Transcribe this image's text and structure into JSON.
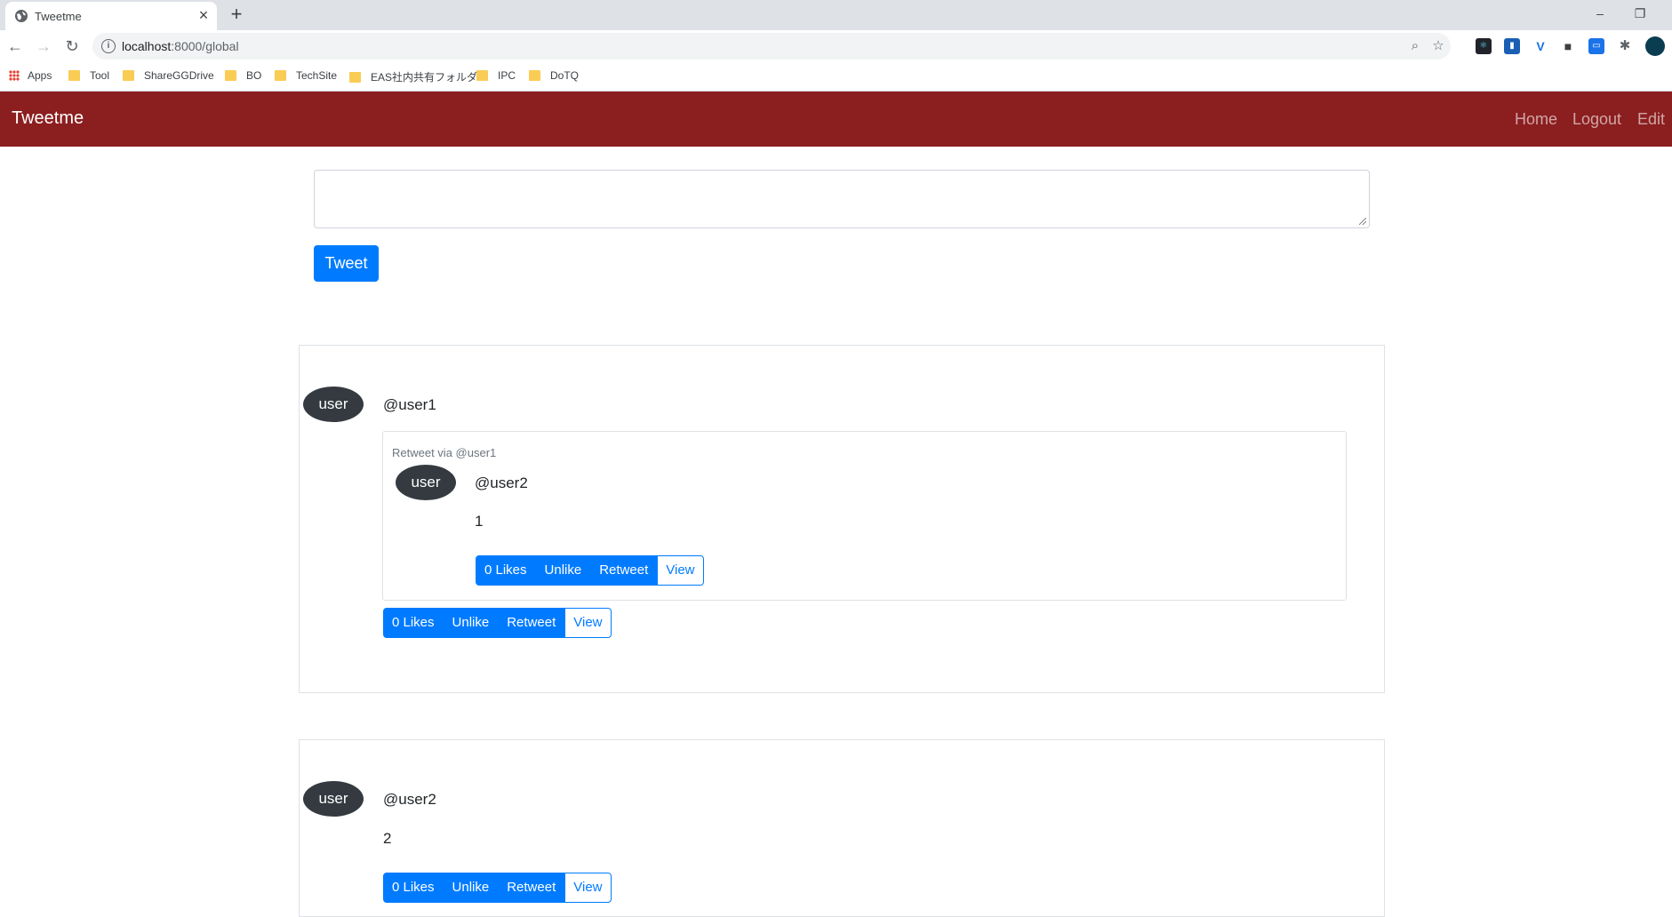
{
  "browser": {
    "tab_title": "Tweetme",
    "url_host": "localhost",
    "url_rest": ":8000/global",
    "bookmarks": [
      {
        "label": "Apps"
      },
      {
        "label": "Tool"
      },
      {
        "label": "ShareGGDrive"
      },
      {
        "label": "BO"
      },
      {
        "label": "TechSite"
      },
      {
        "label": "EAS社内共有フォルダ"
      },
      {
        "label": "IPC"
      },
      {
        "label": "DoTQ"
      }
    ]
  },
  "navbar": {
    "brand": "Tweetme",
    "links": [
      "Home",
      "Logout",
      "Edit"
    ],
    "color": "#8b1e1f"
  },
  "compose": {
    "placeholder": "",
    "submit_label": "Tweet"
  },
  "feed": [
    {
      "avatar": "user",
      "handle": "@user1",
      "retweet": {
        "via": "Retweet via @user1",
        "avatar": "user",
        "handle": "@user2",
        "content": "1",
        "actions": {
          "likes": "0 Likes",
          "unlike": "Unlike",
          "retweet": "Retweet",
          "view": "View"
        }
      },
      "actions": {
        "likes": "0 Likes",
        "unlike": "Unlike",
        "retweet": "Retweet",
        "view": "View"
      }
    },
    {
      "avatar": "user",
      "handle": "@user2",
      "content": "2",
      "actions": {
        "likes": "0 Likes",
        "unlike": "Unlike",
        "retweet": "Retweet",
        "view": "View"
      }
    }
  ],
  "colors": {
    "primary": "#007bff",
    "avatar": "#343a40"
  }
}
